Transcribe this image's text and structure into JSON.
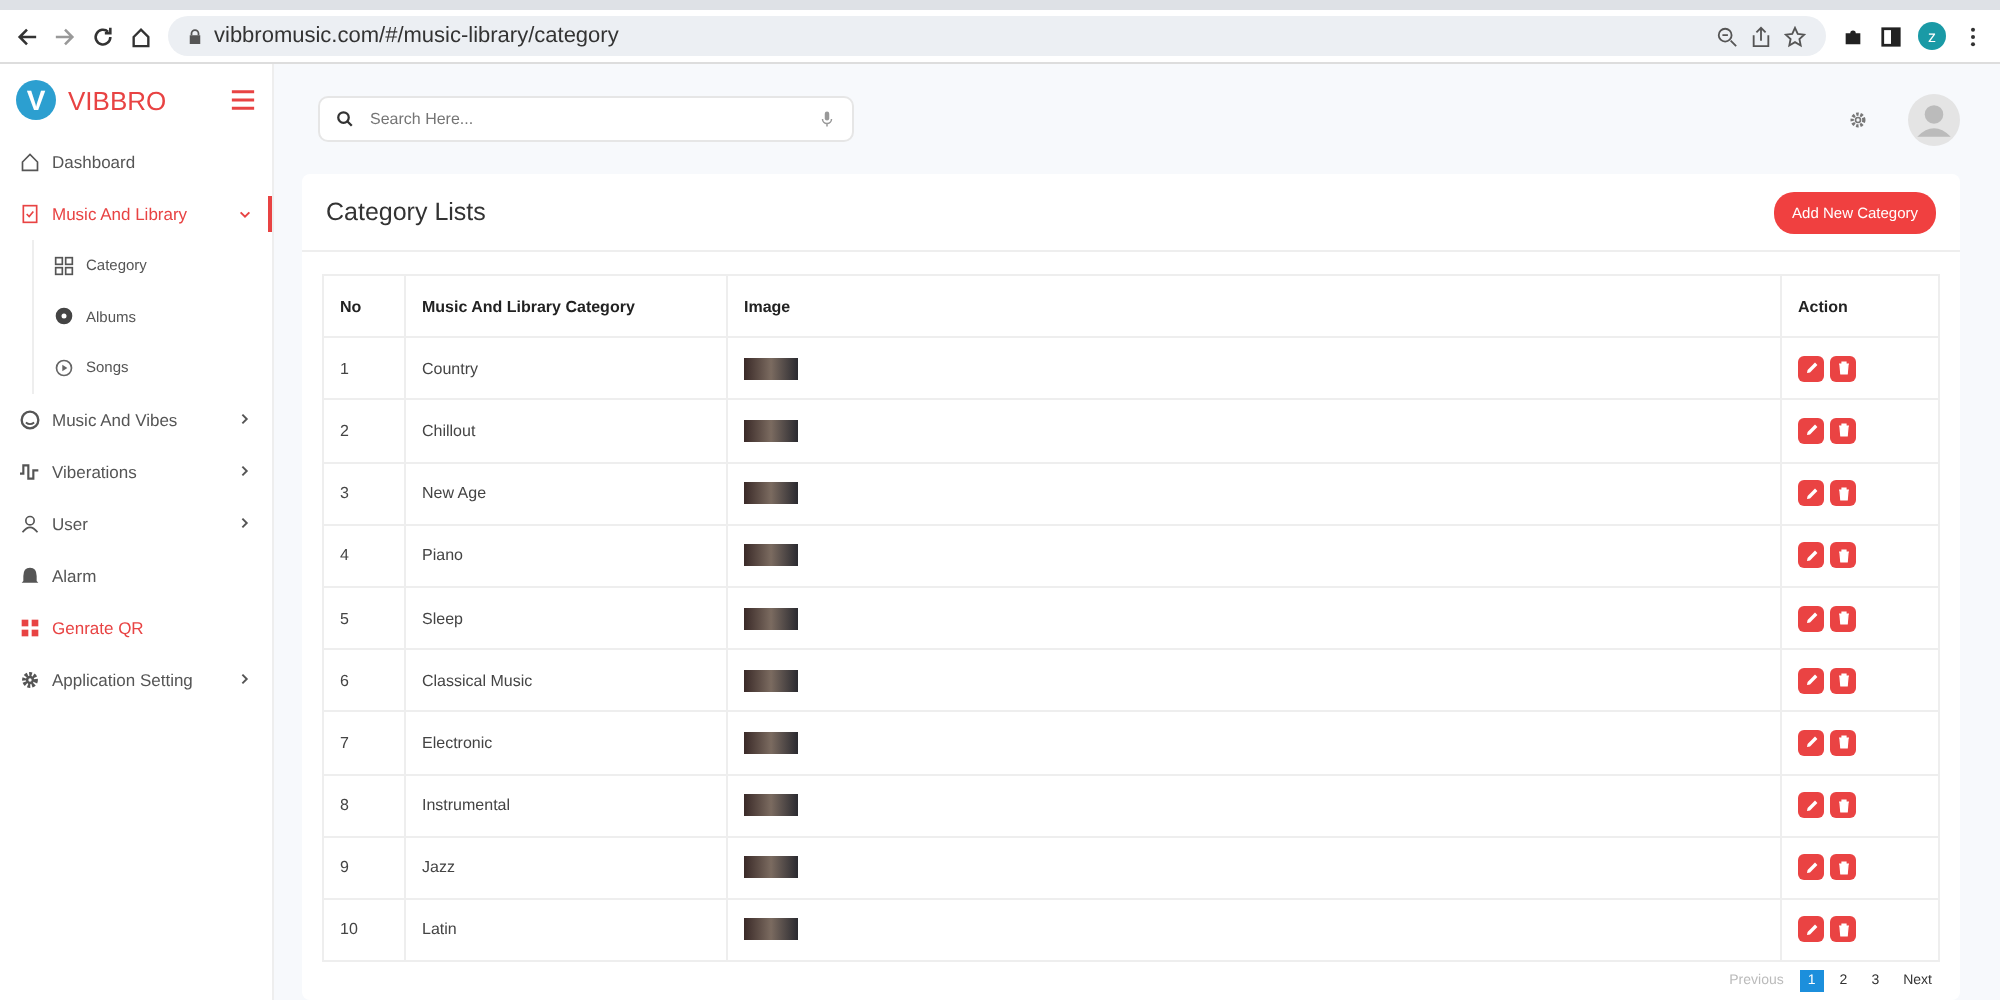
{
  "browser": {
    "url": "vibbromusic.com/#/music-library/category",
    "profile_initial": "z"
  },
  "brand": {
    "name": "VIBBRO",
    "logo_letter": "V"
  },
  "sidebar": {
    "items": [
      {
        "label": "Dashboard",
        "kind": "home",
        "selected": false,
        "accent": false
      },
      {
        "label": "Music And Library",
        "kind": "doc",
        "selected": true,
        "accent": false,
        "expanded": true,
        "children": [
          {
            "label": "Category",
            "kind": "grid",
            "selected": false
          },
          {
            "label": "Albums",
            "kind": "disc",
            "selected": false
          },
          {
            "label": "Songs",
            "kind": "play",
            "selected": false
          }
        ]
      },
      {
        "label": "Music And Vibes",
        "kind": "face",
        "selected": false,
        "accent": false,
        "expanded": false
      },
      {
        "label": "Viberations",
        "kind": "wave",
        "selected": false,
        "accent": false,
        "expanded": false
      },
      {
        "label": "User",
        "kind": "user",
        "selected": false,
        "accent": false,
        "expanded": false
      },
      {
        "label": "Alarm",
        "kind": "bell",
        "selected": false,
        "accent": false
      },
      {
        "label": "Genrate QR",
        "kind": "qr",
        "selected": false,
        "accent": true
      },
      {
        "label": "Application Setting",
        "kind": "gear",
        "selected": false,
        "accent": false,
        "expanded": false
      }
    ]
  },
  "search": {
    "placeholder": "Search Here..."
  },
  "card": {
    "title": "Category Lists",
    "add_button": "Add New Category"
  },
  "table": {
    "columns": [
      "No",
      "Music And Library Category",
      "Image",
      "Action"
    ],
    "rows": [
      {
        "no": "1",
        "category": "Country"
      },
      {
        "no": "2",
        "category": "Chillout"
      },
      {
        "no": "3",
        "category": "New Age"
      },
      {
        "no": "4",
        "category": "Piano"
      },
      {
        "no": "5",
        "category": "Sleep"
      },
      {
        "no": "6",
        "category": "Classical Music"
      },
      {
        "no": "7",
        "category": "Electronic"
      },
      {
        "no": "8",
        "category": "Instrumental"
      },
      {
        "no": "9",
        "category": "Jazz"
      },
      {
        "no": "10",
        "category": "Latin"
      }
    ]
  },
  "pagination": {
    "previous": "Previous",
    "next": "Next",
    "pages": [
      {
        "label": "1",
        "selected": true
      },
      {
        "label": "2",
        "selected": false
      },
      {
        "label": "3",
        "selected": false
      }
    ]
  }
}
